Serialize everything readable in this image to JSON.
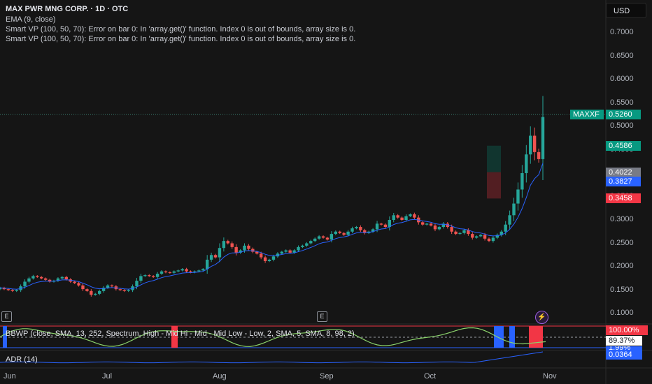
{
  "header": {
    "title": "MAX PWR MNG CORP. · 1D · OTC",
    "lines": [
      "EMA (9, close)",
      "Smart VP (100, 50, 70): Error on bar 0: In 'array.get()' function. Index 0 is out of bounds, array size is 0.",
      "Smart VP (100, 50, 70): Error on bar 0: In 'array.get()' function. Index 0 is out of bounds, array size is 0."
    ]
  },
  "currency_button": "USD",
  "price_scale": [
    "0.7000",
    "0.6500",
    "0.6000",
    "0.5500",
    "0.5000",
    "0.4500",
    "0.4000",
    "0.3500",
    "0.3000",
    "0.2500",
    "0.2000",
    "0.1500",
    "0.1000"
  ],
  "price_labels": {
    "symbol": "MAXXF",
    "last": "0.5260",
    "target": "0.4586",
    "entry": "0.4022",
    "ema": "0.3827",
    "stop": "0.3458"
  },
  "colors": {
    "up": "#26a69a",
    "down": "#ef5350",
    "ema": "#2962ff",
    "target_tag": "#089981",
    "entry_tag": "#787b86",
    "stop_tag": "#f23645",
    "ema_tag": "#2962ff",
    "last_tag": "#089981"
  },
  "oscillators": {
    "bbwp_label": "BBWP (close, SMA, 13, 252, Spectrum, High - Mid Hi - Mid - Mid Low - Low, 2, SMA, 5, SMA, 8, 98, 2)",
    "bbwp_top": "100.00%",
    "bbwp_value": "89.37%",
    "bbwp_bottom": "1.99%",
    "adr_label": "ADR (14)",
    "adr_value": "0.0364"
  },
  "time_axis": [
    "Jun",
    "Jul",
    "Aug",
    "Sep",
    "Oct",
    "Nov"
  ],
  "event_badges": [
    "E",
    "E"
  ],
  "chart_data": {
    "type": "candlestick",
    "title": "MAX PWR MNG CORP. · 1D · OTC",
    "y_range": [
      0.08,
      0.74
    ],
    "x_range": [
      "Jun",
      "Nov"
    ],
    "series": [
      {
        "name": "MAXXF",
        "ohlc_approx_close": [
          0.155,
          0.152,
          0.15,
          0.148,
          0.15,
          0.158,
          0.168,
          0.175,
          0.18,
          0.178,
          0.175,
          0.172,
          0.168,
          0.17,
          0.175,
          0.178,
          0.173,
          0.168,
          0.165,
          0.16,
          0.152,
          0.148,
          0.14,
          0.142,
          0.148,
          0.155,
          0.16,
          0.158,
          0.152,
          0.15,
          0.148,
          0.15,
          0.158,
          0.17,
          0.18,
          0.182,
          0.18,
          0.178,
          0.185,
          0.19,
          0.188,
          0.187,
          0.19,
          0.192,
          0.195,
          0.19,
          0.188,
          0.19,
          0.192,
          0.195,
          0.215,
          0.225,
          0.22,
          0.24,
          0.255,
          0.25,
          0.242,
          0.23,
          0.235,
          0.245,
          0.238,
          0.232,
          0.228,
          0.22,
          0.212,
          0.215,
          0.222,
          0.228,
          0.232,
          0.235,
          0.23,
          0.235,
          0.242,
          0.245,
          0.25,
          0.255,
          0.26,
          0.265,
          0.262,
          0.258,
          0.27,
          0.275,
          0.272,
          0.268,
          0.275,
          0.282,
          0.285,
          0.278,
          0.272,
          0.275,
          0.28,
          0.292,
          0.29,
          0.285,
          0.3,
          0.31,
          0.305,
          0.3,
          0.308,
          0.312,
          0.305,
          0.295,
          0.29,
          0.292,
          0.288,
          0.28,
          0.285,
          0.292,
          0.285,
          0.275,
          0.27,
          0.272,
          0.278,
          0.27,
          0.262,
          0.265,
          0.268,
          0.26,
          0.255,
          0.262,
          0.268,
          0.275,
          0.29,
          0.31,
          0.335,
          0.365,
          0.4,
          0.44,
          0.48,
          0.445,
          0.43,
          0.52
        ]
      },
      {
        "name": "EMA (9, close)",
        "value_last": 0.3827
      }
    ],
    "annotations": {
      "target": 0.4586,
      "entry": 0.4022,
      "stop": 0.3458,
      "last": 0.526
    },
    "grid": false,
    "legend": "top-left"
  }
}
